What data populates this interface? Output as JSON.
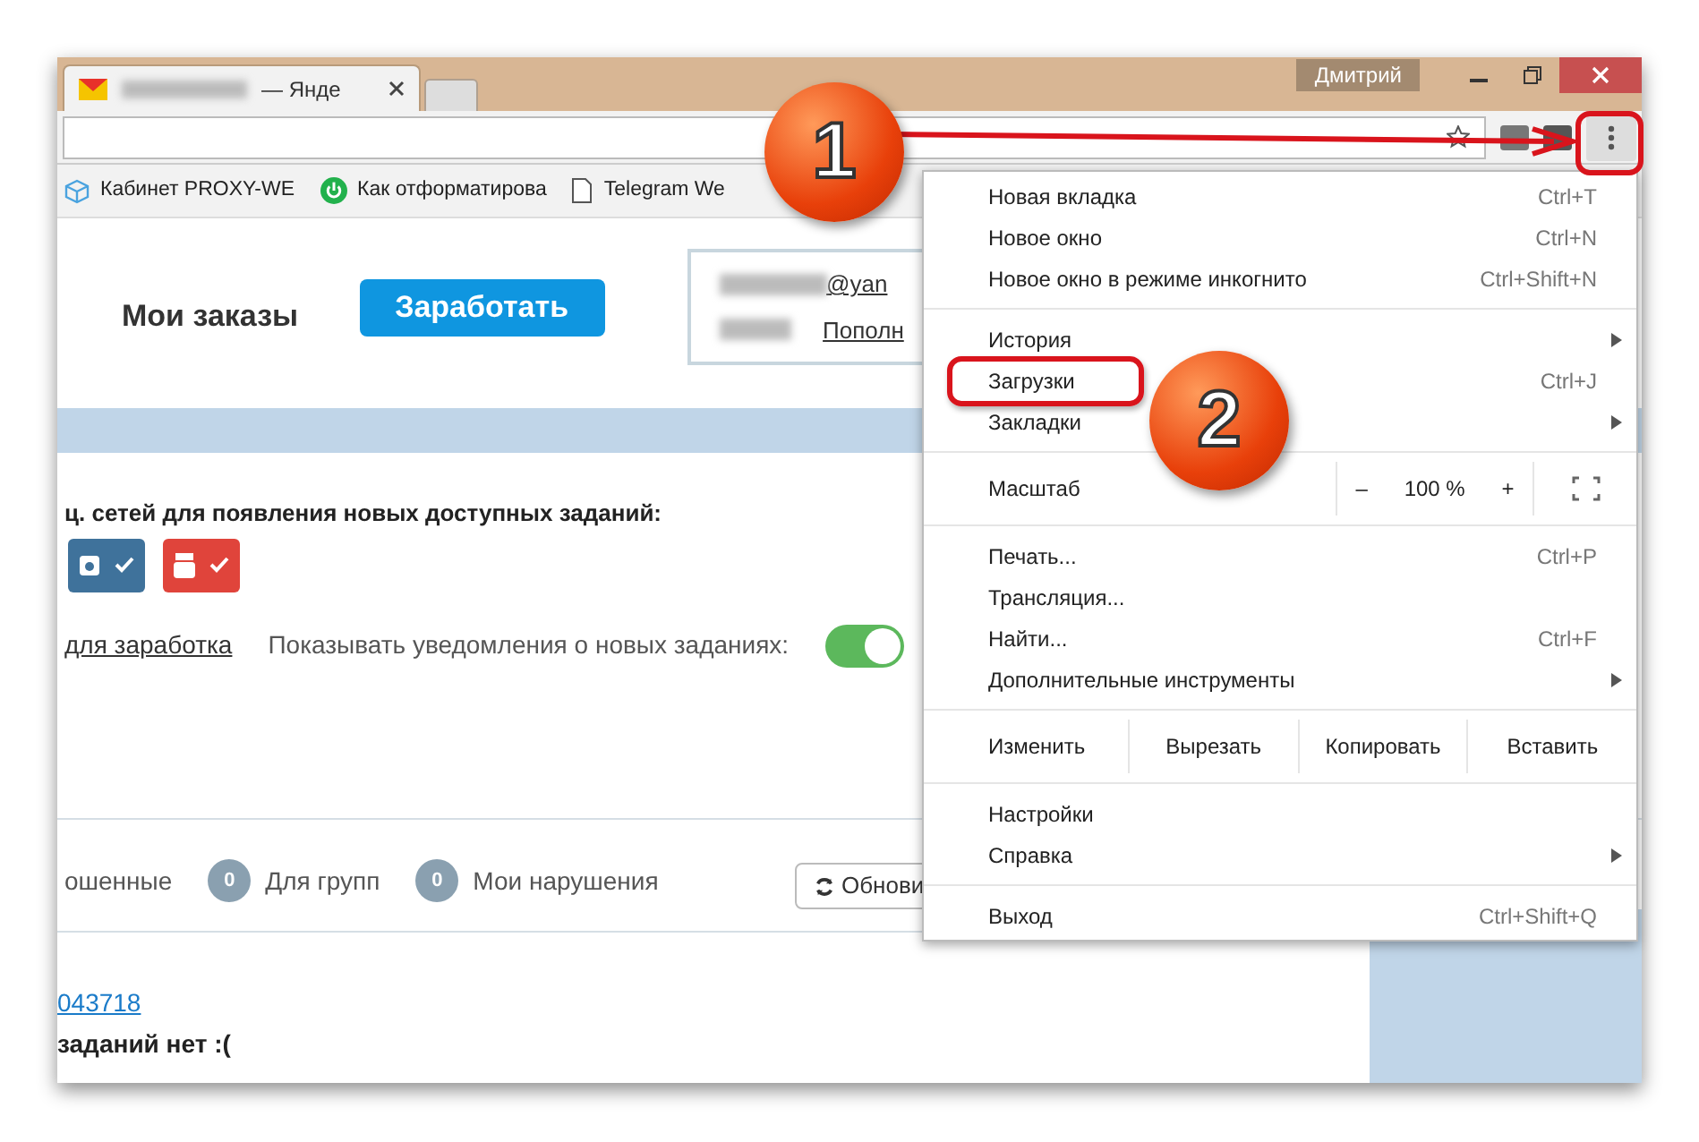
{
  "window": {
    "tab_title": "— Янде",
    "user": "Дмитрий"
  },
  "bookmarks": [
    {
      "kind": "cube",
      "label": "Кабинет PROXY-WE"
    },
    {
      "kind": "power",
      "label": "Как отформатирова"
    },
    {
      "kind": "doc",
      "label": "Telegram We"
    }
  ],
  "header": {
    "orders": "Мои заказы",
    "earn_button": "Заработать",
    "email": "@yan",
    "topup": "Пополн"
  },
  "social": {
    "prompt": "ц. сетей для появления новых доступных заданий:",
    "buttons": [
      {
        "kind": "instagram",
        "checked": true
      },
      {
        "kind": "youtube",
        "checked": true
      }
    ]
  },
  "notify": {
    "link": "для заработка",
    "label": "Показывать уведомления о новых заданиях:",
    "on": true
  },
  "filters": [
    {
      "label": "ошенные"
    },
    {
      "count": "0",
      "label": "Для групп"
    },
    {
      "count": "0",
      "label": "Мои нарушения"
    }
  ],
  "refresh_button": "Обнови",
  "task_link": "043718",
  "empty_text": "заданий нет :(",
  "menu": [
    {
      "kind": "item",
      "label": "Новая вкладка",
      "shortcut": "Ctrl+T",
      "submenu": false
    },
    {
      "kind": "item",
      "label": "Новое окно",
      "shortcut": "Ctrl+N",
      "submenu": false
    },
    {
      "kind": "item",
      "label": "Новое окно в режиме инкогнито",
      "shortcut": "Ctrl+Shift+N",
      "submenu": false
    },
    {
      "kind": "separator"
    },
    {
      "kind": "item",
      "label": "История",
      "submenu": true
    },
    {
      "kind": "item",
      "label": "Загрузки",
      "shortcut": "Ctrl+J",
      "submenu": false,
      "highlighted": true
    },
    {
      "kind": "item",
      "label": "Закладки",
      "submenu": true
    },
    {
      "kind": "separator"
    },
    {
      "kind": "zoom",
      "label": "Масштаб",
      "minus": "–",
      "value": "100 %",
      "plus": "+"
    },
    {
      "kind": "separator"
    },
    {
      "kind": "item",
      "label": "Печать...",
      "shortcut": "Ctrl+P",
      "submenu": false
    },
    {
      "kind": "item",
      "label": "Трансляция...",
      "submenu": false
    },
    {
      "kind": "item",
      "label": "Найти...",
      "shortcut": "Ctrl+F",
      "submenu": false
    },
    {
      "kind": "item",
      "label": "Дополнительные инструменты",
      "submenu": true
    },
    {
      "kind": "separator"
    },
    {
      "kind": "edit",
      "label": "Изменить",
      "actions": [
        "Вырезать",
        "Копировать",
        "Вставить"
      ]
    },
    {
      "kind": "separator"
    },
    {
      "kind": "item",
      "label": "Настройки",
      "submenu": false
    },
    {
      "kind": "item",
      "label": "Справка",
      "submenu": true
    },
    {
      "kind": "separator"
    },
    {
      "kind": "item",
      "label": "Выход",
      "shortcut": "Ctrl+Shift+Q",
      "submenu": false
    }
  ],
  "annotations": [
    {
      "number": "1"
    },
    {
      "number": "2"
    }
  ]
}
